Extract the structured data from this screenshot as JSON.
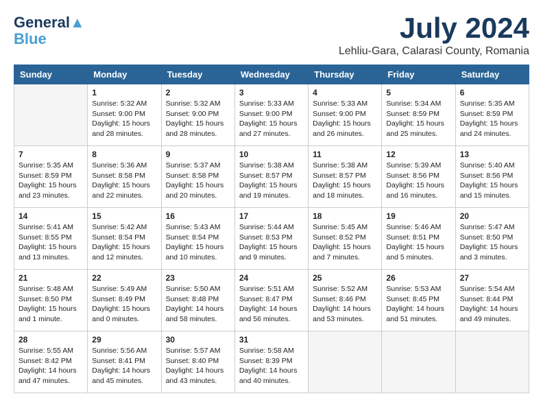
{
  "header": {
    "logo_line1": "General",
    "logo_line2": "Blue",
    "month": "July 2024",
    "location": "Lehliu-Gara, Calarasi County, Romania"
  },
  "weekdays": [
    "Sunday",
    "Monday",
    "Tuesday",
    "Wednesday",
    "Thursday",
    "Friday",
    "Saturday"
  ],
  "weeks": [
    [
      {
        "day": "",
        "info": ""
      },
      {
        "day": "1",
        "info": "Sunrise: 5:32 AM\nSunset: 9:00 PM\nDaylight: 15 hours\nand 28 minutes."
      },
      {
        "day": "2",
        "info": "Sunrise: 5:32 AM\nSunset: 9:00 PM\nDaylight: 15 hours\nand 28 minutes."
      },
      {
        "day": "3",
        "info": "Sunrise: 5:33 AM\nSunset: 9:00 PM\nDaylight: 15 hours\nand 27 minutes."
      },
      {
        "day": "4",
        "info": "Sunrise: 5:33 AM\nSunset: 9:00 PM\nDaylight: 15 hours\nand 26 minutes."
      },
      {
        "day": "5",
        "info": "Sunrise: 5:34 AM\nSunset: 8:59 PM\nDaylight: 15 hours\nand 25 minutes."
      },
      {
        "day": "6",
        "info": "Sunrise: 5:35 AM\nSunset: 8:59 PM\nDaylight: 15 hours\nand 24 minutes."
      }
    ],
    [
      {
        "day": "7",
        "info": "Sunrise: 5:35 AM\nSunset: 8:59 PM\nDaylight: 15 hours\nand 23 minutes."
      },
      {
        "day": "8",
        "info": "Sunrise: 5:36 AM\nSunset: 8:58 PM\nDaylight: 15 hours\nand 22 minutes."
      },
      {
        "day": "9",
        "info": "Sunrise: 5:37 AM\nSunset: 8:58 PM\nDaylight: 15 hours\nand 20 minutes."
      },
      {
        "day": "10",
        "info": "Sunrise: 5:38 AM\nSunset: 8:57 PM\nDaylight: 15 hours\nand 19 minutes."
      },
      {
        "day": "11",
        "info": "Sunrise: 5:38 AM\nSunset: 8:57 PM\nDaylight: 15 hours\nand 18 minutes."
      },
      {
        "day": "12",
        "info": "Sunrise: 5:39 AM\nSunset: 8:56 PM\nDaylight: 15 hours\nand 16 minutes."
      },
      {
        "day": "13",
        "info": "Sunrise: 5:40 AM\nSunset: 8:56 PM\nDaylight: 15 hours\nand 15 minutes."
      }
    ],
    [
      {
        "day": "14",
        "info": "Sunrise: 5:41 AM\nSunset: 8:55 PM\nDaylight: 15 hours\nand 13 minutes."
      },
      {
        "day": "15",
        "info": "Sunrise: 5:42 AM\nSunset: 8:54 PM\nDaylight: 15 hours\nand 12 minutes."
      },
      {
        "day": "16",
        "info": "Sunrise: 5:43 AM\nSunset: 8:54 PM\nDaylight: 15 hours\nand 10 minutes."
      },
      {
        "day": "17",
        "info": "Sunrise: 5:44 AM\nSunset: 8:53 PM\nDaylight: 15 hours\nand 9 minutes."
      },
      {
        "day": "18",
        "info": "Sunrise: 5:45 AM\nSunset: 8:52 PM\nDaylight: 15 hours\nand 7 minutes."
      },
      {
        "day": "19",
        "info": "Sunrise: 5:46 AM\nSunset: 8:51 PM\nDaylight: 15 hours\nand 5 minutes."
      },
      {
        "day": "20",
        "info": "Sunrise: 5:47 AM\nSunset: 8:50 PM\nDaylight: 15 hours\nand 3 minutes."
      }
    ],
    [
      {
        "day": "21",
        "info": "Sunrise: 5:48 AM\nSunset: 8:50 PM\nDaylight: 15 hours\nand 1 minute."
      },
      {
        "day": "22",
        "info": "Sunrise: 5:49 AM\nSunset: 8:49 PM\nDaylight: 15 hours\nand 0 minutes."
      },
      {
        "day": "23",
        "info": "Sunrise: 5:50 AM\nSunset: 8:48 PM\nDaylight: 14 hours\nand 58 minutes."
      },
      {
        "day": "24",
        "info": "Sunrise: 5:51 AM\nSunset: 8:47 PM\nDaylight: 14 hours\nand 56 minutes."
      },
      {
        "day": "25",
        "info": "Sunrise: 5:52 AM\nSunset: 8:46 PM\nDaylight: 14 hours\nand 53 minutes."
      },
      {
        "day": "26",
        "info": "Sunrise: 5:53 AM\nSunset: 8:45 PM\nDaylight: 14 hours\nand 51 minutes."
      },
      {
        "day": "27",
        "info": "Sunrise: 5:54 AM\nSunset: 8:44 PM\nDaylight: 14 hours\nand 49 minutes."
      }
    ],
    [
      {
        "day": "28",
        "info": "Sunrise: 5:55 AM\nSunset: 8:42 PM\nDaylight: 14 hours\nand 47 minutes."
      },
      {
        "day": "29",
        "info": "Sunrise: 5:56 AM\nSunset: 8:41 PM\nDaylight: 14 hours\nand 45 minutes."
      },
      {
        "day": "30",
        "info": "Sunrise: 5:57 AM\nSunset: 8:40 PM\nDaylight: 14 hours\nand 43 minutes."
      },
      {
        "day": "31",
        "info": "Sunrise: 5:58 AM\nSunset: 8:39 PM\nDaylight: 14 hours\nand 40 minutes."
      },
      {
        "day": "",
        "info": ""
      },
      {
        "day": "",
        "info": ""
      },
      {
        "day": "",
        "info": ""
      }
    ]
  ]
}
